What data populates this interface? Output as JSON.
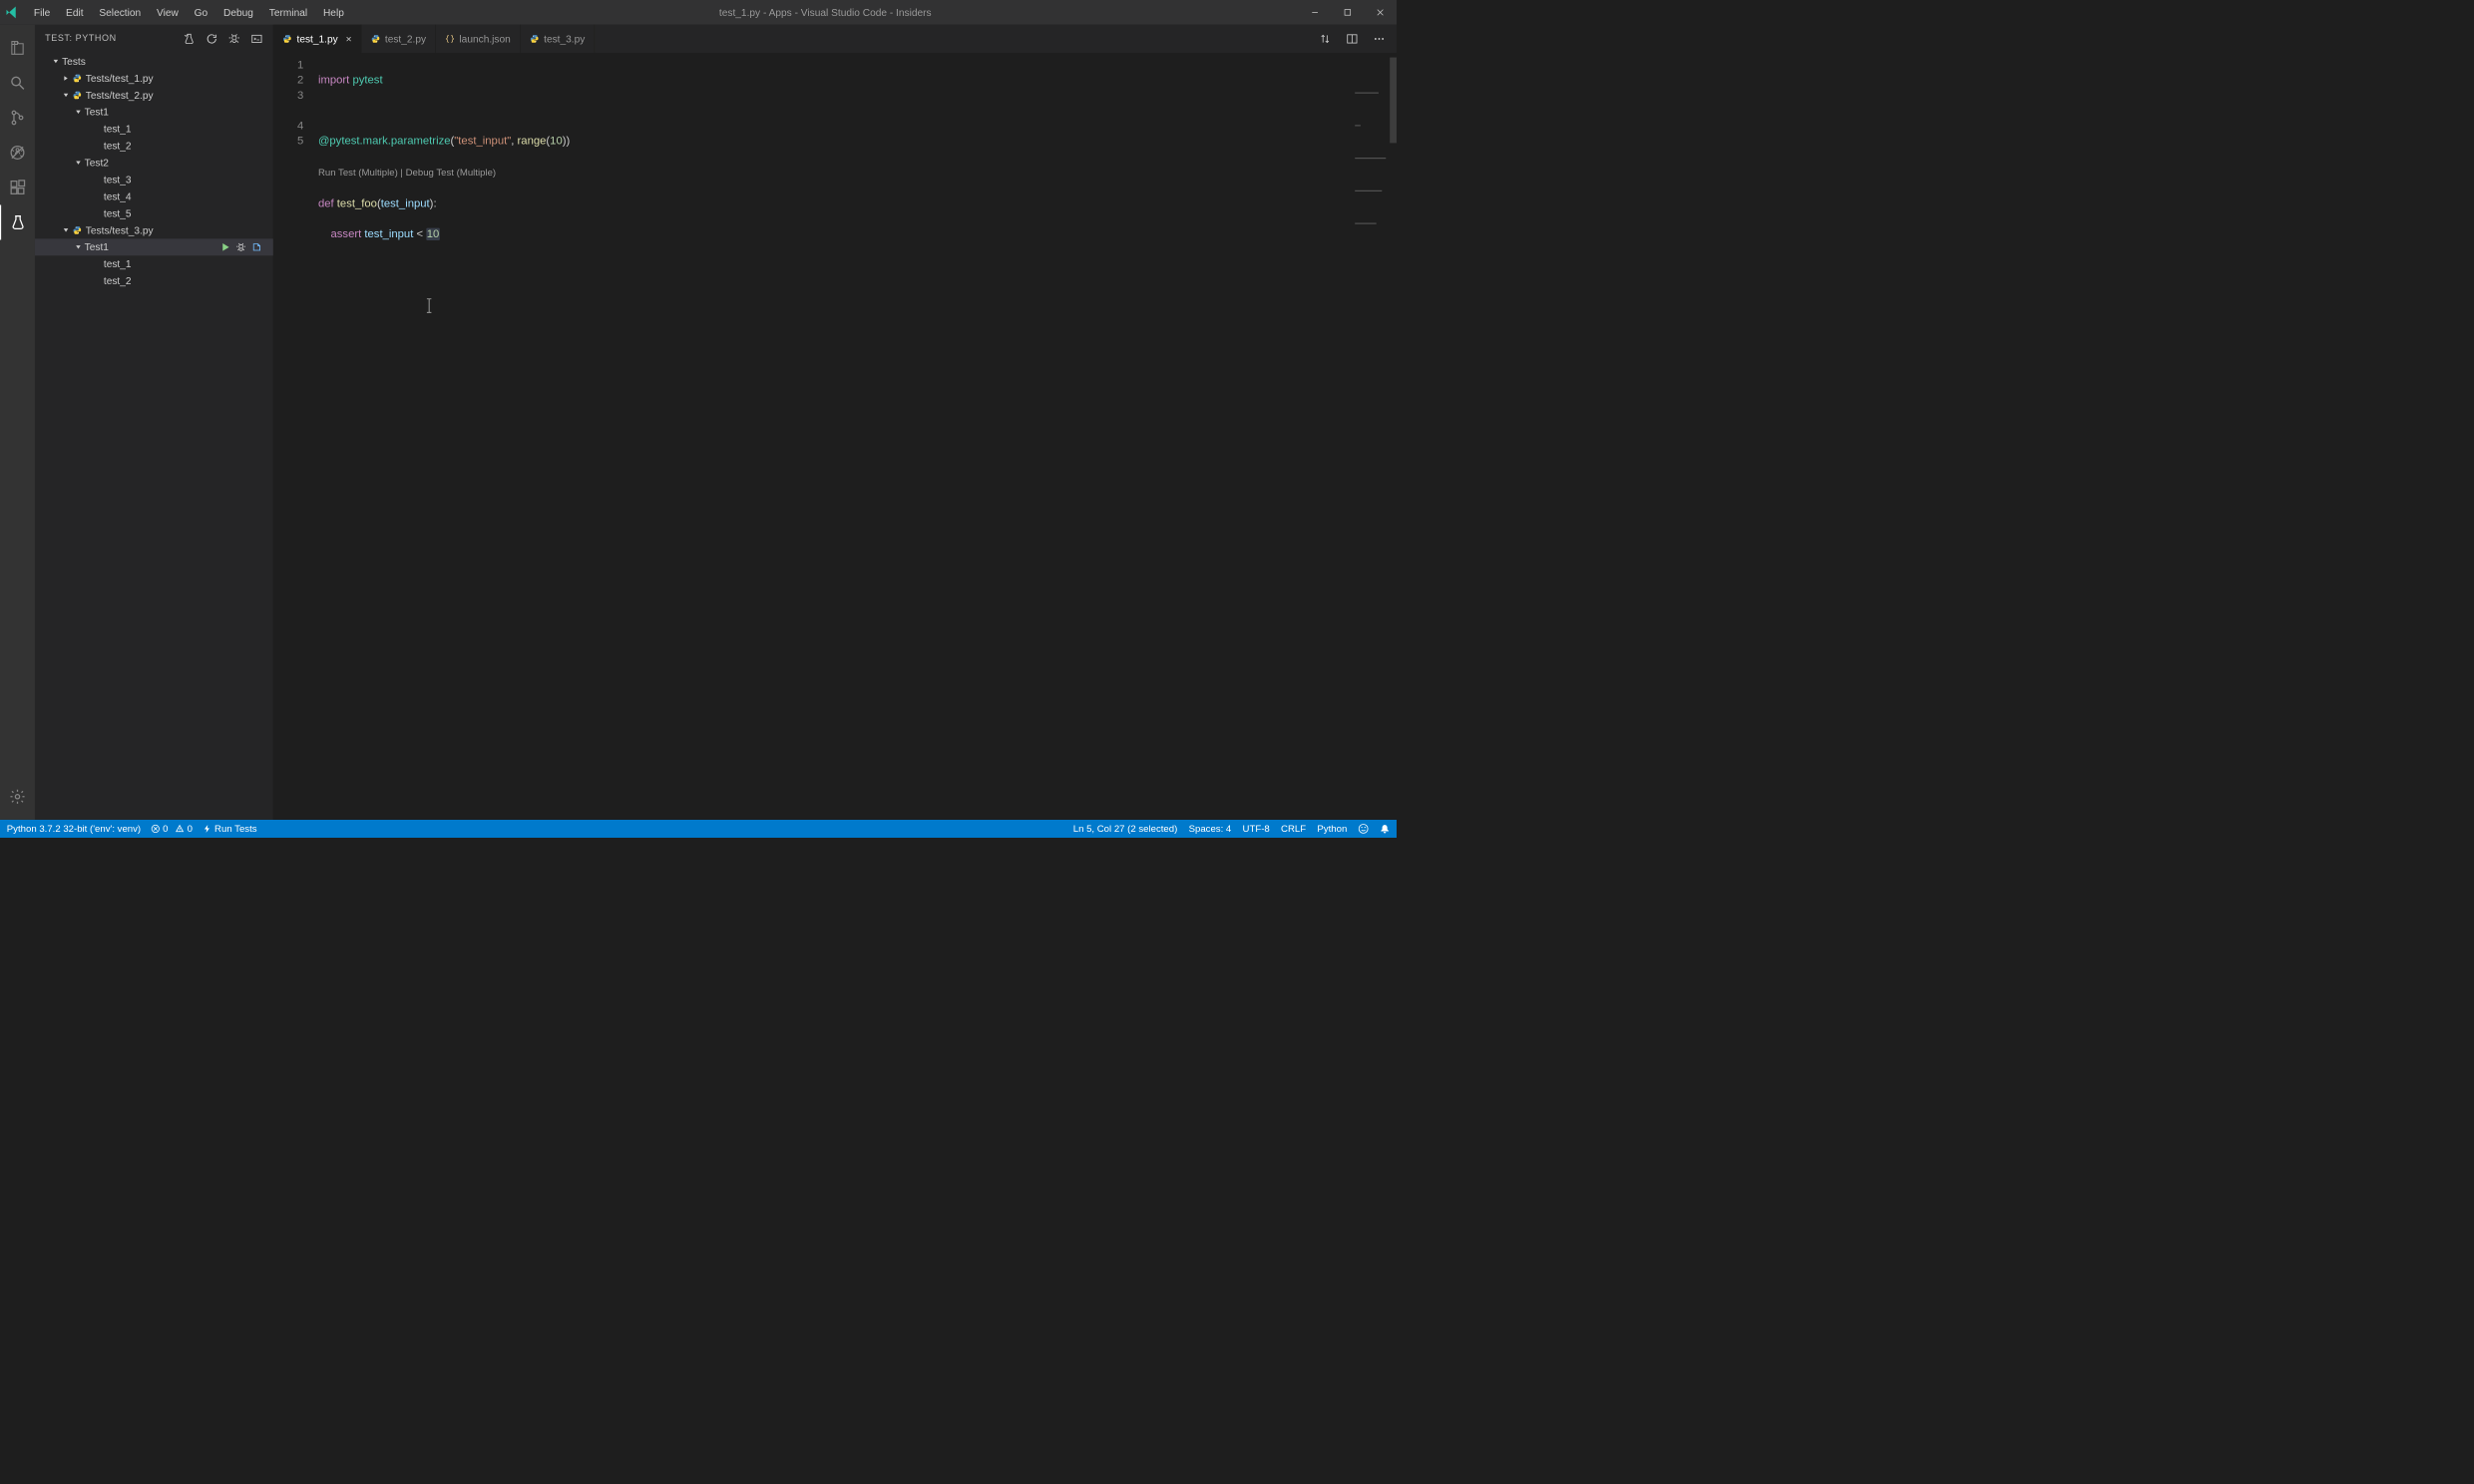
{
  "menu": [
    "File",
    "Edit",
    "Selection",
    "View",
    "Go",
    "Debug",
    "Terminal",
    "Help"
  ],
  "title": "test_1.py - Apps - Visual Studio Code - Insiders",
  "sidebar": {
    "title": "TEST: PYTHON",
    "root": "Tests",
    "files": [
      {
        "name": "Tests/test_1.py",
        "expanded": false
      },
      {
        "name": "Tests/test_2.py",
        "expanded": true,
        "groups": [
          {
            "name": "Test1",
            "tests": [
              "test_1",
              "test_2"
            ]
          },
          {
            "name": "Test2",
            "tests": [
              "test_3",
              "test_4",
              "test_5"
            ]
          }
        ]
      },
      {
        "name": "Tests/test_3.py",
        "expanded": true,
        "groups": [
          {
            "name": "Test1",
            "selected": true,
            "tests": [
              "test_1",
              "test_2"
            ]
          }
        ]
      }
    ]
  },
  "tabs": [
    {
      "label": "test_1.py",
      "icon": "python",
      "active": true,
      "dirty": false
    },
    {
      "label": "test_2.py",
      "icon": "python",
      "active": false
    },
    {
      "label": "launch.json",
      "icon": "braces",
      "active": false
    },
    {
      "label": "test_3.py",
      "icon": "python",
      "active": false
    }
  ],
  "code": {
    "lines": [
      {
        "n": 1
      },
      {
        "n": 2
      },
      {
        "n": 3
      },
      {
        "n": 4
      },
      {
        "n": 5
      }
    ],
    "l1_kw": "import",
    "l1_mod": "pytest",
    "l3_dec": "@pytest.mark.parametrize",
    "l3_paren_open": "(",
    "l3_str": "\"test_input\"",
    "l3_sep": ", ",
    "l3_fn": "range",
    "l3_open2": "(",
    "l3_num": "10",
    "l3_close": "))",
    "codelens_run": "Run Test (Multiple)",
    "codelens_sep": " | ",
    "codelens_debug": "Debug Test (Multiple)",
    "l4_kw": "def",
    "l4_fn": "test_foo",
    "l4_paren": "(",
    "l4_param": "test_input",
    "l4_close": "):",
    "l5_indent": "    ",
    "l5_kw": "assert",
    "l5_sp": " ",
    "l5_var": "test_input",
    "l5_op": " < ",
    "l5_num": "10"
  },
  "statusbar": {
    "python": "Python 3.7.2 32-bit ('env': venv)",
    "errors": "0",
    "warnings": "0",
    "run_tests": "Run Tests",
    "position": "Ln 5, Col 27 (2 selected)",
    "spaces": "Spaces: 4",
    "encoding": "UTF-8",
    "eol": "CRLF",
    "lang": "Python"
  }
}
